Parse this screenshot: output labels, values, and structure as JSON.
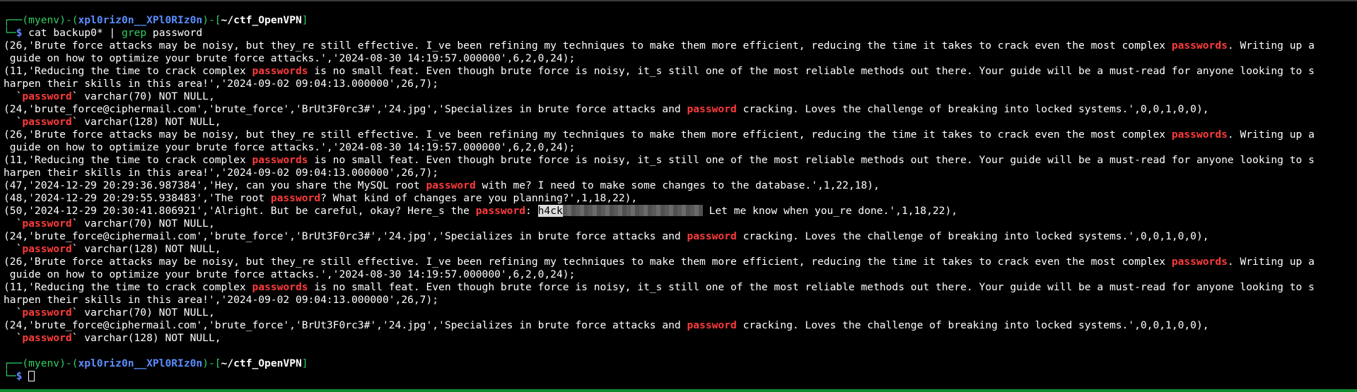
{
  "prompt": {
    "env": "(myenv)",
    "user": "xpl0riz0n__XPl0RIz0n",
    "dir": "~/ctf_OpenVPN",
    "dollar": "$"
  },
  "command": {
    "cat": "cat backup0* | ",
    "grep": "grep",
    "arg": " password"
  },
  "lines": [
    {
      "a": "(26,'Brute force attacks may be noisy, but they_re still effective. I_ve been refining my techniques to make them more efficient, reducing the time it takes to crack even the most complex ",
      "k": "passwords",
      "b": ". Writing up a"
    },
    {
      "a": " guide on how to optimize your brute force attacks.','2024-08-30 14:19:57.000000',6,2,0,24);"
    },
    {
      "a": "(11,'Reducing the time to crack complex ",
      "k": "passwords",
      "b": " is no small feat. Even though brute force is noisy, it_s still one of the most reliable methods out there. Your guide will be a must-read for anyone looking to s"
    },
    {
      "a": "harpen their skills in this area!','2024-09-02 09:04:13.000000',26,7);"
    },
    {
      "a": "  `",
      "k": "password",
      "b": "` varchar(70) NOT NULL,"
    },
    {
      "a": "(24,'brute_force@ciphermail.com','brute_force','BrUt3F0rc3#','24.jpg','Specializes in brute force attacks and ",
      "k": "password",
      "b": " cracking. Loves the challenge of breaking into locked systems.',0,0,1,0,0),"
    },
    {
      "a": "  `",
      "k": "password",
      "b": "` varchar(128) NOT NULL,"
    },
    {
      "a": "(26,'Brute force attacks may be noisy, but they_re still effective. I_ve been refining my techniques to make them more efficient, reducing the time it takes to crack even the most complex ",
      "k": "passwords",
      "b": ". Writing up a"
    },
    {
      "a": " guide on how to optimize your brute force attacks.','2024-08-30 14:19:57.000000',6,2,0,24);"
    },
    {
      "a": "(11,'Reducing the time to crack complex ",
      "k": "passwords",
      "b": " is no small feat. Even though brute force is noisy, it_s still one of the most reliable methods out there. Your guide will be a must-read for anyone looking to s"
    },
    {
      "a": "harpen their skills in this area!','2024-09-02 09:04:13.000000',26,7);"
    },
    {
      "a": "(47,'2024-12-29 20:29:36.987384','Hey, can you share the MySQL root ",
      "k": "password",
      "b": " with me? I need to make some changes to the database.',1,22,18),"
    },
    {
      "a": "(48,'2024-12-29 20:29:55.938483','The root ",
      "k": "password",
      "b": "? What kind of changes are you planning?',1,18,22),"
    },
    {
      "a": "(50,'2024-12-29 20:30:41.806921','Alright. But be careful, okay? Here_s the ",
      "k": "password",
      "b": ": ",
      "sel": "h4ck",
      "c": " Let me know when you_re done.',1,18,22),"
    },
    {
      "a": "  `",
      "k": "password",
      "b": "` varchar(70) NOT NULL,"
    },
    {
      "a": "(24,'brute_force@ciphermail.com','brute_force','BrUt3F0rc3#','24.jpg','Specializes in brute force attacks and ",
      "k": "password",
      "b": " cracking. Loves the challenge of breaking into locked systems.',0,0,1,0,0),"
    },
    {
      "a": "  `",
      "k": "password",
      "b": "` varchar(128) NOT NULL,"
    },
    {
      "a": "(26,'Brute force attacks may be noisy, but they_re still effective. I_ve been refining my techniques to make them more efficient, reducing the time it takes to crack even the most complex ",
      "k": "passwords",
      "b": ". Writing up a"
    },
    {
      "a": " guide on how to optimize your brute force attacks.','2024-08-30 14:19:57.000000',6,2,0,24);"
    },
    {
      "a": "(11,'Reducing the time to crack complex ",
      "k": "passwords",
      "b": " is no small feat. Even though brute force is noisy, it_s still one of the most reliable methods out there. Your guide will be a must-read for anyone looking to s"
    },
    {
      "a": "harpen their skills in this area!','2024-09-02 09:04:13.000000',26,7);"
    },
    {
      "a": "  `",
      "k": "password",
      "b": "` varchar(70) NOT NULL,"
    },
    {
      "a": "(24,'brute_force@ciphermail.com','brute_force','BrUt3F0rc3#','24.jpg','Specializes in brute force attacks and ",
      "k": "password",
      "b": " cracking. Loves the challenge of breaking into locked systems.',0,0,1,0,0),"
    },
    {
      "a": "  `",
      "k": "password",
      "b": "` varchar(128) NOT NULL,"
    }
  ],
  "colors": {
    "background": "#000000",
    "prompt_green": "#2fd162",
    "prompt_blue": "#5b8dff",
    "highlight_red": "#ff3b3b"
  }
}
